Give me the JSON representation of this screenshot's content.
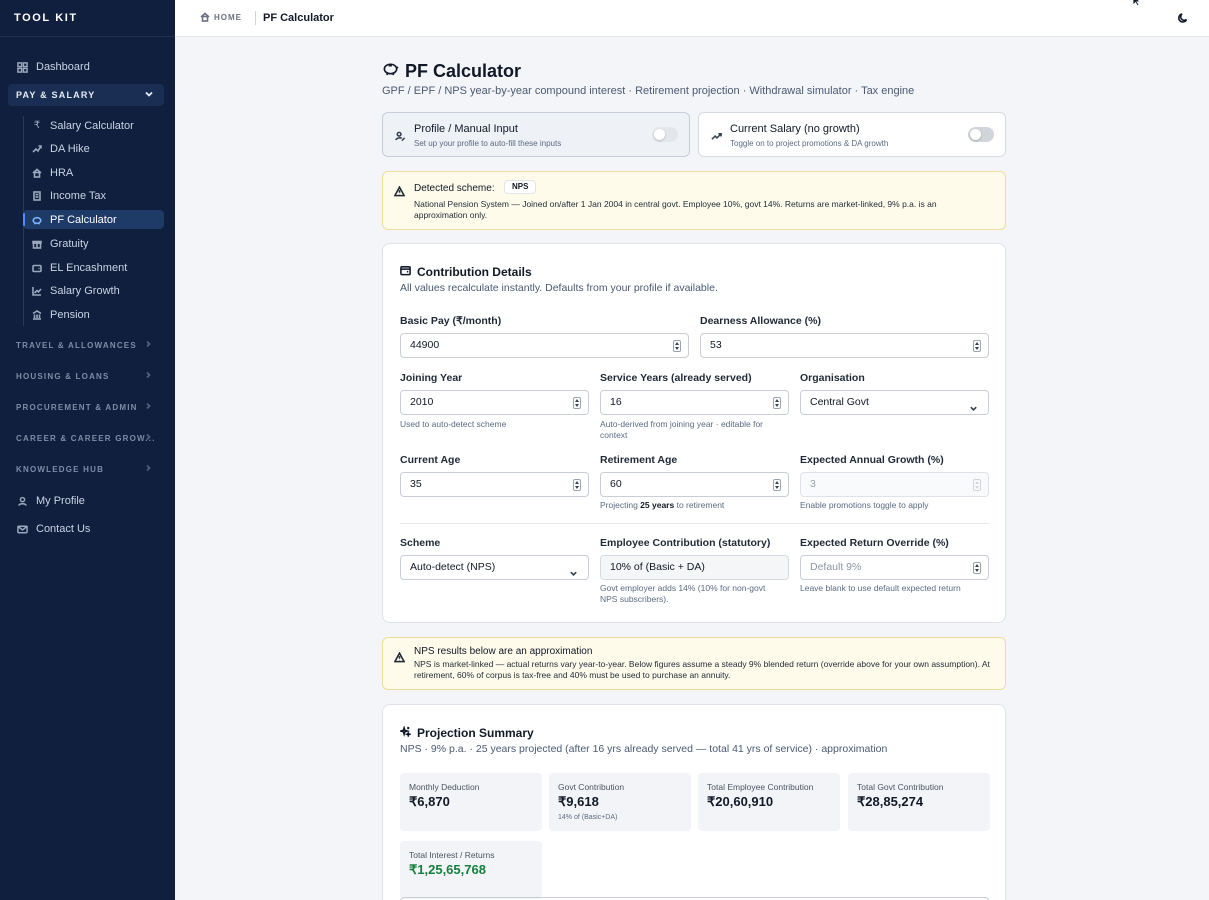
{
  "sidebar": {
    "brand": "TOOL KIT",
    "dashboard": "Dashboard",
    "group": "PAY & SALARY",
    "items": [
      {
        "label": "Salary Calculator",
        "icon": "rupee-icon"
      },
      {
        "label": "DA Hike",
        "icon": "trend-icon"
      },
      {
        "label": "HRA",
        "icon": "house-icon"
      },
      {
        "label": "Income Tax",
        "icon": "receipt-icon"
      },
      {
        "label": "PF Calculator",
        "icon": "piggy-bank-icon",
        "active": true
      },
      {
        "label": "Gratuity",
        "icon": "gift-icon"
      },
      {
        "label": "EL Encashment",
        "icon": "wallet-icon"
      },
      {
        "label": "Salary Growth",
        "icon": "chart-icon"
      },
      {
        "label": "Pension",
        "icon": "landmark-icon"
      }
    ],
    "collapsed_groups": [
      "TRAVEL & ALLOWANCES",
      "HOUSING & LOANS",
      "PROCUREMENT & ADMIN",
      "CAREER & CAREER GROW...",
      "KNOWLEDGE HUB"
    ],
    "my_profile": "My Profile",
    "contact_us": "Contact Us"
  },
  "topbar": {
    "home": "HOME",
    "current": "PF Calculator"
  },
  "page": {
    "title": "PF Calculator",
    "subtitle": "GPF / EPF / NPS year-by-year compound interest · Retirement projection · Withdrawal simulator · Tax engine"
  },
  "toggles": {
    "profile": {
      "title": "Profile / Manual Input",
      "desc": "Set up your profile to auto-fill these inputs",
      "on": false
    },
    "salary": {
      "title": "Current Salary (no growth)",
      "desc": "Toggle on to project promotions & DA growth",
      "on": false
    }
  },
  "detected": {
    "label": "Detected scheme:",
    "badge": "NPS",
    "body": "National Pension System — Joined on/after 1 Jan 2004 in central govt. Employee 10%, govt 14%. Returns are market-linked, 9% p.a. is an approximation only."
  },
  "contribution": {
    "title": "Contribution Details",
    "desc": "All values recalculate instantly. Defaults from your profile if available.",
    "basic_pay": {
      "label": "Basic Pay (₹/month)",
      "value": "44900"
    },
    "da": {
      "label": "Dearness Allowance (%)",
      "value": "53"
    },
    "joining_year": {
      "label": "Joining Year",
      "value": "2010",
      "hint": "Used to auto-detect scheme"
    },
    "service_years": {
      "label": "Service Years (already served)",
      "value": "16",
      "hint": "Auto-derived from joining year · editable for context"
    },
    "organisation": {
      "label": "Organisation",
      "value": "Central Govt"
    },
    "current_age": {
      "label": "Current Age",
      "value": "35"
    },
    "retirement_age": {
      "label": "Retirement Age",
      "value": "60",
      "hint_pre": "Projecting ",
      "hint_bold": "25 years",
      "hint_post": " to retirement"
    },
    "growth": {
      "label": "Expected Annual Growth (%)",
      "value": "3",
      "hint": "Enable promotions toggle to apply"
    },
    "scheme": {
      "label": "Scheme",
      "value": "Auto-detect (NPS)"
    },
    "employee_contrib": {
      "label": "Employee Contribution (statutory)",
      "value": "10% of (Basic + DA)",
      "hint": "Govt employer adds 14% (10% for non-govt NPS subscribers)."
    },
    "return_override": {
      "label": "Expected Return Override (%)",
      "placeholder": "Default 9%",
      "hint": "Leave blank to use default expected return"
    }
  },
  "nps_warning": {
    "title": "NPS results below are an approximation",
    "body": "NPS is market-linked — actual returns vary year-to-year. Below figures assume a steady 9% blended return (override above for your own assumption). At retirement, 60% of corpus is tax-free and 40% must be used to purchase an annuity."
  },
  "projection": {
    "title": "Projection Summary",
    "desc": "NPS · 9% p.a. · 25 years projected (after 16 yrs already served — total 41 yrs of service) · approximation",
    "stats": [
      {
        "label": "Monthly Deduction",
        "value": "₹6,870",
        "note": ""
      },
      {
        "label": "Govt Contribution",
        "value": "₹9,618",
        "note": "14% of (Basic+DA)"
      },
      {
        "label": "Total Employee Contribution",
        "value": "₹20,60,910",
        "note": ""
      },
      {
        "label": "Total Govt Contribution",
        "value": "₹28,85,274",
        "note": ""
      },
      {
        "label": "Total Interest / Returns",
        "value": "₹1,25,65,768",
        "note": ""
      }
    ]
  },
  "colors": {
    "sidebar_bg": "#0f1f3d",
    "active_item_bg": "#1e3a66",
    "alert_bg": "#fefbea",
    "returns_green": "#15803d"
  }
}
